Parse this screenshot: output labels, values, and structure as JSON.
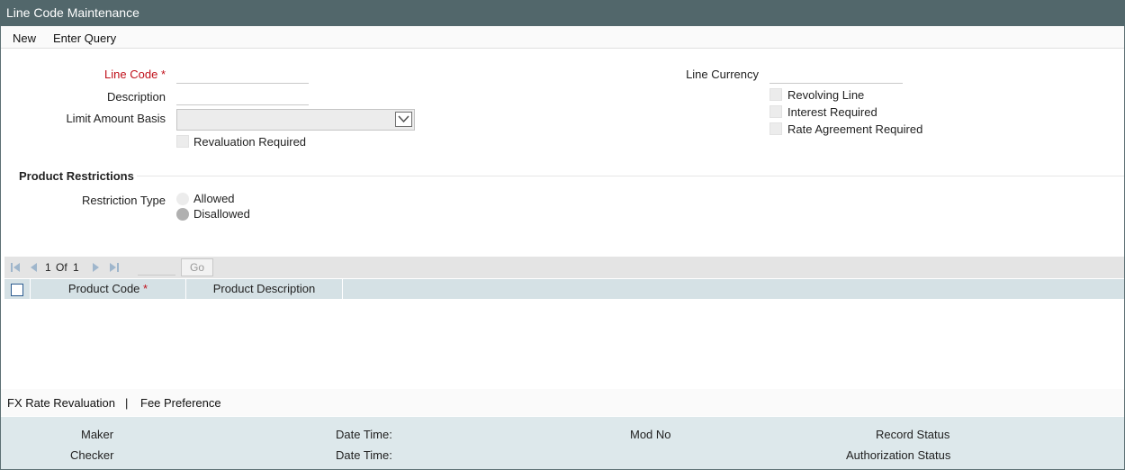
{
  "window": {
    "title": "Line Code Maintenance"
  },
  "menu": {
    "new": "New",
    "enter_query": "Enter Query"
  },
  "form": {
    "line_code_label": "Line Code",
    "required_marker": "*",
    "line_code_value": "",
    "description_label": "Description",
    "description_value": "",
    "limit_amount_basis_label": "Limit Amount Basis",
    "limit_amount_basis_value": "",
    "revaluation_required_label": "Revaluation Required",
    "line_currency_label": "Line Currency",
    "line_currency_value": "",
    "revolving_line_label": "Revolving Line",
    "interest_required_label": "Interest Required",
    "rate_agreement_required_label": "Rate Agreement Required"
  },
  "product_restrictions": {
    "section_title": "Product Restrictions",
    "restriction_type_label": "Restriction Type",
    "options": [
      "Allowed",
      "Disallowed"
    ],
    "selected": "Disallowed"
  },
  "pager": {
    "current": "1",
    "of_label": "Of",
    "total": "1",
    "page_input": "",
    "go_label": "Go"
  },
  "grid": {
    "columns": [
      "Product Code",
      "Product Description"
    ],
    "required_marker": "*",
    "rows": []
  },
  "bottom_links": {
    "fx_rate_revaluation": "FX Rate Revaluation",
    "separator": "|",
    "fee_preference": "Fee Preference"
  },
  "audit": {
    "maker": "Maker",
    "checker": "Checker",
    "date_time_1": "Date Time:",
    "date_time_2": "Date Time:",
    "mod_no": "Mod No",
    "record_status": "Record Status",
    "authorization_status": "Authorization Status"
  }
}
